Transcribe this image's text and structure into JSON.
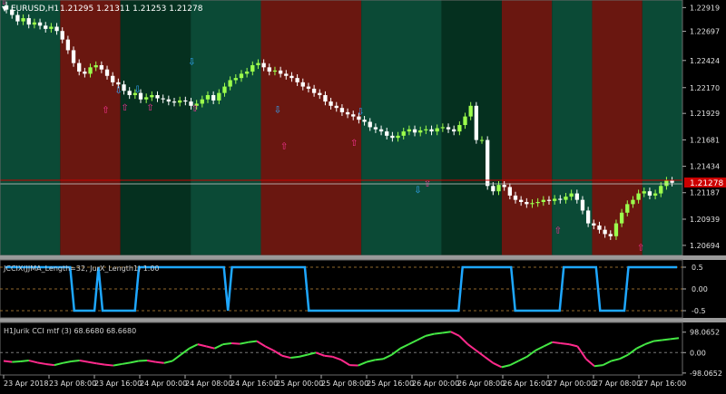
{
  "main_chart": {
    "symbol_label": "EURUSD,H1",
    "ohlc_label": "1.21295 1.21311 1.21253 1.21278",
    "collapse_glyph": "▼",
    "current_price": "1.21278",
    "y_ticks": [
      "1.22919",
      "1.22697",
      "1.22424",
      "1.22170",
      "1.21929",
      "1.21681",
      "1.21434",
      "1.21187",
      "1.20939",
      "1.20694"
    ],
    "colors": {
      "bull_candle": "#9cff4c",
      "bear_candle": "#ffffff",
      "zone_green": "#0b4a36",
      "zone_red": "#6a1710",
      "zone_dark": "#05301f",
      "up_arrow": "#ff3399",
      "down_arrow": "#33aaff",
      "price_line": "#cc0000"
    },
    "zones": [
      {
        "from": 0,
        "to": 12,
        "color": "zone_green"
      },
      {
        "from": 12,
        "to": 24,
        "color": "zone_red"
      },
      {
        "from": 24,
        "to": 38,
        "color": "zone_dark"
      },
      {
        "from": 38,
        "to": 52,
        "color": "zone_green"
      },
      {
        "from": 52,
        "to": 72,
        "color": "zone_red"
      },
      {
        "from": 72,
        "to": 88,
        "color": "zone_green"
      },
      {
        "from": 88,
        "to": 100,
        "color": "zone_dark"
      },
      {
        "from": 100,
        "to": 110,
        "color": "zone_red"
      },
      {
        "from": 110,
        "to": 118,
        "color": "zone_green"
      },
      {
        "from": 118,
        "to": 128,
        "color": "zone_red"
      },
      {
        "from": 128,
        "to": 136,
        "color": "zone_green"
      }
    ],
    "close_prices": [
      1.229,
      1.2285,
      1.2279,
      1.2282,
      1.2276,
      1.2278,
      1.2275,
      1.2272,
      1.2274,
      1.227,
      1.2262,
      1.2252,
      1.224,
      1.2232,
      1.223,
      1.2236,
      1.2238,
      1.2234,
      1.2228,
      1.2222,
      1.222,
      1.2214,
      1.221,
      1.2212,
      1.2206,
      1.2208,
      1.221,
      1.2207,
      1.2206,
      1.2204,
      1.2203,
      1.2205,
      1.2204,
      1.22,
      1.2202,
      1.2206,
      1.221,
      1.2205,
      1.2212,
      1.2218,
      1.2224,
      1.2226,
      1.223,
      1.2232,
      1.2238,
      1.224,
      1.2236,
      1.2232,
      1.2233,
      1.223,
      1.2228,
      1.2226,
      1.2222,
      1.2218,
      1.2216,
      1.2212,
      1.221,
      1.2204,
      1.22,
      1.2198,
      1.2194,
      1.2192,
      1.219,
      1.2187,
      1.2185,
      1.218,
      1.2178,
      1.2176,
      1.2172,
      1.217,
      1.2172,
      1.2176,
      1.2178,
      1.2175,
      1.2177,
      1.2178,
      1.2176,
      1.2179,
      1.218,
      1.2178,
      1.2176,
      1.2182,
      1.219,
      1.22,
      1.2168,
      1.2168,
      1.2125,
      1.212,
      1.2126,
      1.2124,
      1.2116,
      1.2112,
      1.211,
      1.2108,
      1.2109,
      1.211,
      1.2112,
      1.2111,
      1.2113,
      1.2112,
      1.2115,
      1.2118,
      1.2112,
      1.2102,
      1.209,
      1.2088,
      1.2084,
      1.208,
      1.2078,
      1.209,
      1.21,
      1.2108,
      1.2112,
      1.2118,
      1.212,
      1.2116,
      1.2118,
      1.2125,
      1.213,
      1.2128
    ],
    "buy_arrows": [
      [
        0,
        1.2298
      ],
      [
        32,
        1.2197
      ],
      [
        38,
        1.2199
      ],
      [
        46,
        1.2199
      ],
      [
        60,
        1.2198
      ],
      [
        88,
        1.2163
      ],
      [
        110,
        1.2166
      ],
      [
        133,
        1.2128
      ],
      [
        174,
        1.2084
      ],
      [
        200,
        1.2068
      ]
    ],
    "sell_arrows": [
      [
        36,
        1.2215
      ],
      [
        42,
        1.2216
      ],
      [
        59,
        1.2242
      ],
      [
        86,
        1.2197
      ],
      [
        112,
        1.2195
      ],
      [
        130,
        1.2122
      ]
    ]
  },
  "jccx_panel": {
    "label": "JCCIX(JJMA_Length=32, JurX_Length1) 1.00",
    "y_ticks": [
      "0.5",
      "0.00",
      "-0.5"
    ],
    "line_color": "#1ea7ff",
    "levels": [
      0.5,
      0.5,
      0.5,
      0.5,
      0.5,
      0.5,
      0.5,
      0.5,
      0.5,
      0.5,
      0.5,
      0.5,
      0.5,
      0.5,
      0.5,
      0.5,
      0.5,
      -0.5,
      -0.5,
      -0.5,
      -0.5,
      -0.5,
      -0.5,
      0.5,
      -0.5,
      -0.5,
      -0.5,
      -0.5,
      -0.5,
      -0.5,
      -0.5,
      -0.5,
      -0.5,
      0.5,
      0.5,
      0.5,
      0.5,
      0.5,
      0.5,
      0.5,
      0.5,
      0.5,
      0.5,
      0.5,
      0.5,
      0.5,
      0.5,
      0.5,
      0.5,
      0.5,
      0.5,
      0.5,
      0.5,
      0.5,
      0.5,
      -0.5,
      0.5,
      0.5,
      0.5,
      0.5,
      0.5,
      0.5,
      0.5,
      0.5,
      0.5,
      0.5,
      0.5,
      0.5,
      0.5,
      0.5,
      0.5,
      0.5,
      0.5,
      0.5,
      0.5,
      -0.5,
      -0.5,
      -0.5,
      -0.5,
      -0.5,
      -0.5,
      -0.5,
      -0.5,
      -0.5,
      -0.5,
      -0.5,
      -0.5,
      -0.5,
      -0.5,
      -0.5,
      -0.5,
      -0.5,
      -0.5,
      -0.5,
      -0.5,
      -0.5,
      -0.5,
      -0.5,
      -0.5,
      -0.5,
      -0.5,
      -0.5,
      -0.5,
      -0.5,
      -0.5,
      -0.5,
      -0.5,
      -0.5,
      -0.5,
      -0.5,
      -0.5,
      -0.5,
      -0.5,
      0.5,
      0.5,
      0.5,
      0.5,
      0.5,
      0.5,
      0.5,
      0.5,
      0.5,
      0.5,
      0.5,
      0.5,
      0.5,
      -0.5,
      -0.5,
      -0.5,
      -0.5,
      -0.5,
      -0.5,
      -0.5,
      -0.5,
      -0.5,
      -0.5,
      -0.5,
      -0.5,
      0.5,
      0.5,
      0.5,
      0.5,
      0.5,
      0.5,
      0.5,
      0.5,
      0.5,
      -0.5,
      -0.5,
      -0.5,
      -0.5,
      -0.5,
      -0.5,
      -0.5,
      0.5,
      0.5,
      0.5,
      0.5,
      0.5,
      0.5,
      0.5,
      0.5,
      0.5,
      0.5,
      0.5,
      0.5,
      0.5
    ]
  },
  "cci_panel": {
    "label": "H1Jurik CCI mtf (3) 68.6680 68.6680",
    "y_ticks": [
      "98.0652",
      "0.00",
      "-98.0652"
    ],
    "colors": {
      "up": "#44e844",
      "down": "#ff2a8c",
      "zero": "#777777"
    },
    "values": [
      -40,
      -45,
      -42,
      -38,
      -48,
      -55,
      -60,
      -50,
      -42,
      -38,
      -45,
      -52,
      -58,
      -62,
      -55,
      -48,
      -40,
      -38,
      -45,
      -50,
      -40,
      -10,
      20,
      40,
      30,
      20,
      40,
      45,
      42,
      50,
      55,
      30,
      10,
      -15,
      -25,
      -20,
      -10,
      0,
      -15,
      -20,
      -35,
      -60,
      -62,
      -45,
      -35,
      -30,
      -10,
      20,
      40,
      60,
      80,
      90,
      95,
      100,
      80,
      40,
      10,
      -20,
      -50,
      -70,
      -60,
      -40,
      -20,
      10,
      30,
      50,
      45,
      40,
      30,
      -30,
      -65,
      -60,
      -40,
      -30,
      -10,
      20,
      40,
      55,
      60,
      65,
      70
    ],
    "x_ticks": [
      "23 Apr 2018",
      "23 Apr 08:00",
      "23 Apr 16:00",
      "24 Apr 00:00",
      "24 Apr 08:00",
      "24 Apr 16:00",
      "25 Apr 00:00",
      "25 Apr 08:00",
      "25 Apr 16:00",
      "26 Apr 00:00",
      "26 Apr 08:00",
      "26 Apr 16:00",
      "27 Apr 00:00",
      "27 Apr 08:00",
      "27 Apr 16:00"
    ]
  }
}
